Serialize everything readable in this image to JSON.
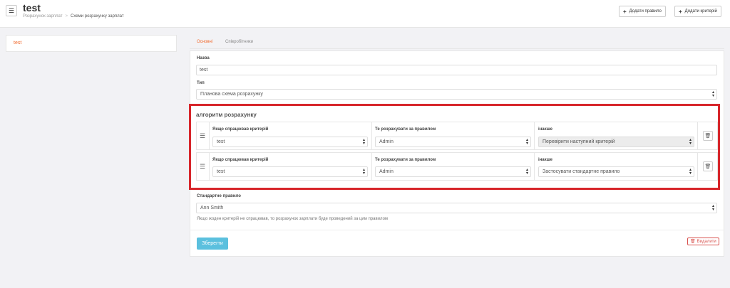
{
  "header": {
    "title": "test",
    "breadcrumb": [
      "Розрахунок зарплат",
      "Схеми розрахунку зарплат"
    ],
    "add_rule_label": "Додати правило",
    "add_criterion_label": "Додати критерій"
  },
  "sidebar": {
    "items": [
      {
        "label": "test",
        "active": true
      }
    ]
  },
  "tabs": [
    {
      "label": "Основні",
      "active": true
    },
    {
      "label": "Співробітники",
      "active": false
    }
  ],
  "form": {
    "name_label": "Назва",
    "name_value": "test",
    "type_label": "Тип",
    "type_value": "Планова схема розрахунку",
    "algorithm": {
      "title": "алгоритм розрахунку",
      "rows": [
        {
          "criterion_label": "Якщо спрацював критерій",
          "criterion_value": "test",
          "rule_label": "Те розрахувати за правилом",
          "rule_value": "Admin",
          "else_label": "інакше",
          "else_value": "Перевірити наступний критерій",
          "else_disabled": true
        },
        {
          "criterion_label": "Якщо спрацював критерій",
          "criterion_value": "test",
          "rule_label": "Те розрахувати за правилом",
          "rule_value": "Admin",
          "else_label": "інакше",
          "else_value": "Застосувати стандартне правило",
          "else_disabled": false
        }
      ]
    },
    "default_rule_label": "Стандартне правило",
    "default_rule_value": "Ann Smith",
    "default_rule_hint": "Якщо жоден критерій не спрацював, то розрахунок зарплати буде проведений за цим правилом",
    "save_label": "Зберегти",
    "delete_label": "Видалити"
  },
  "colors": {
    "accent": "#f26b2e",
    "highlight_border": "#d7262b",
    "save_button": "#5bc0de",
    "delete": "#d9534f"
  }
}
